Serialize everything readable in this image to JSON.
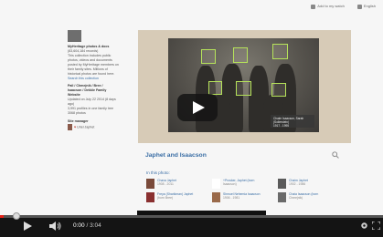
{
  "topbar": {
    "link_1": "Add to my watch",
    "link_2": "English"
  },
  "sidebar": {
    "title": "MyHeritage photos & docs",
    "count": "(83,604,184 records)",
    "desc_1": "This collection includes public",
    "desc_2": "photos, videos and documents",
    "desc_3": "posted by MyHeritage members on",
    "desc_4": "their family sites. Millions of",
    "desc_5": "historical photos are found here.",
    "link": "Search this collection",
    "sub_1": "Pail / Chmejnik / Bree /",
    "sub_2": "Isaacson / Dekkle Family",
    "sub_3": "Website",
    "updated_1": "Updated on July 22 2014 (8 days",
    "updated_2": "ago)",
    "profiles_1": "3,991 profiles in one family tree",
    "profiles_2": "3068 photos",
    "manager_label": "Site manager",
    "manager_name": "Uriel Japhet"
  },
  "photo": {
    "caption_1": "Chaim Isaacson, Sarah (Sollerstein)",
    "caption_2": "1917 - 1995"
  },
  "main": {
    "title": "Japhet and Isaacson",
    "in_photo_label": "In this photo:"
  },
  "people": [
    {
      "name": "Chava Japhet",
      "years": "1908 - 2011",
      "color": "#7a4a3a"
    },
    {
      "name": "+Prosker, Japhet (born",
      "years": "Isaacson)",
      "color": "#ffffff"
    },
    {
      "name": "Chaim Japhet",
      "years": "1902 - 1986",
      "color": "#5a5a5a"
    },
    {
      "name": "Freya (Sharikman) Japhet",
      "years": "(born Bree)",
      "color": "#8a3030"
    },
    {
      "name": "Shmuel Nehemia Isaacson",
      "years": "1906 - 1981",
      "color": "#9a6a4a"
    },
    {
      "name": "Chaia Isaacson (born",
      "years": "Chmejnik)",
      "color": "#6a6a6a"
    }
  ],
  "player": {
    "current_time": "0:00",
    "separator": " / ",
    "duration": "3:04",
    "progress": 0.01
  }
}
